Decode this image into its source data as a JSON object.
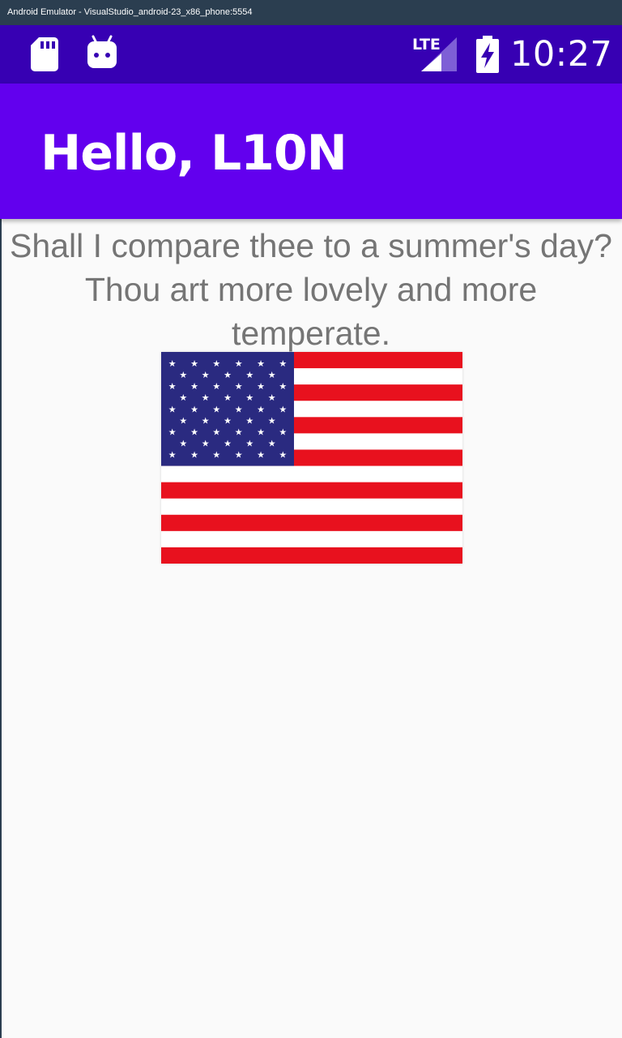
{
  "window": {
    "title": "Android Emulator - VisualStudio_android-23_x86_phone:5554"
  },
  "status_bar": {
    "time": "10:27",
    "network_label": "LTE",
    "icons": [
      "sd-card-icon",
      "android-debug-icon",
      "lte-signal-icon",
      "battery-charging-icon"
    ],
    "color": "#3700b3"
  },
  "app_bar": {
    "title": "Hello, L10N",
    "color": "#6200ee"
  },
  "main": {
    "text": "Shall I compare thee to a summer's day? Thou art more lovely and more temperate.",
    "text_color": "#757575",
    "image": {
      "icon": "us-flag-image",
      "colors": {
        "red": "#e8111e",
        "white": "#ffffff",
        "blue": "#2a2a80"
      }
    }
  }
}
